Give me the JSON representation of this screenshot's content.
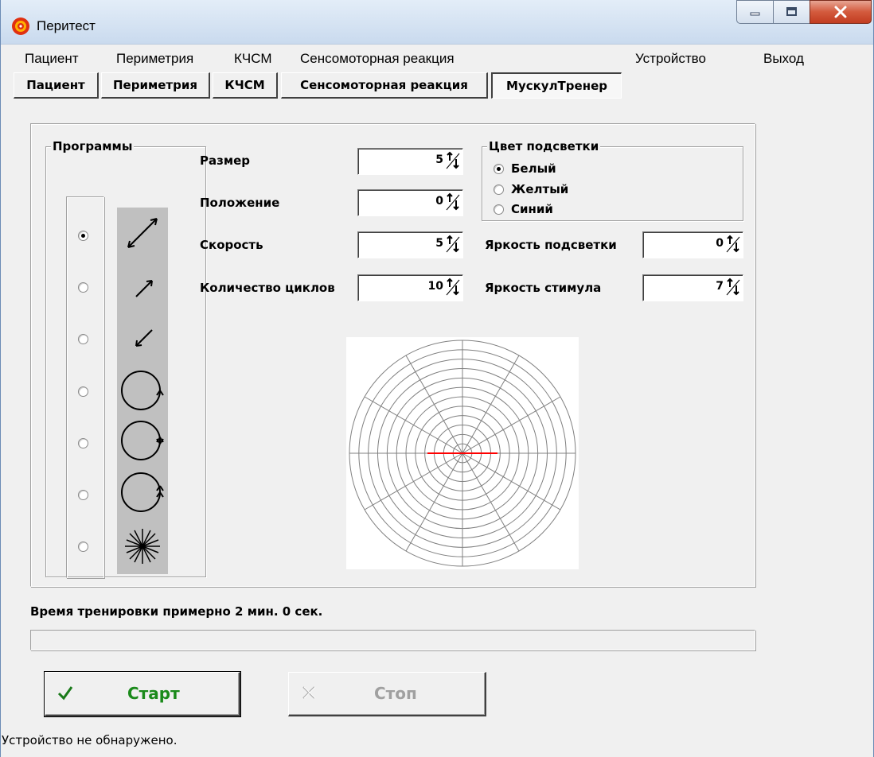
{
  "window": {
    "title": "Перитест",
    "app_icon": "peritest-app-icon",
    "controls": [
      "minimize-icon",
      "maximize-icon",
      "close-icon"
    ]
  },
  "menu": {
    "items": [
      "Пациент",
      "Периметрия",
      "КЧСМ",
      "Сенсомоторная реакция",
      "Устройство",
      "Выход"
    ]
  },
  "tabs": {
    "items": [
      "Пациент",
      "Периметрия",
      "КЧСМ",
      "Сенсомоторная реакция",
      "МускулТренер"
    ],
    "active": "МускулТренер"
  },
  "programs": {
    "title": "Программы",
    "selected_index": 0,
    "icons": [
      "diagonal-double-arrow-icon",
      "arrow-up-right-icon",
      "arrow-down-left-icon",
      "circle-arrow-icon",
      "circle-double-arrow-icon",
      "circle-triple-arrow-icon",
      "star-burst-icon"
    ]
  },
  "params": {
    "size": {
      "label": "Размер",
      "value": "5"
    },
    "position": {
      "label": "Положение",
      "value": "0"
    },
    "speed": {
      "label": "Скорость",
      "value": "5"
    },
    "cycles": {
      "label": "Количество циклов",
      "value": "10"
    },
    "backlight_brightness": {
      "label": "Яркость подсветки",
      "value": "0"
    },
    "stimulus_brightness": {
      "label": "Яркость стимула",
      "value": "7"
    }
  },
  "backlight_color": {
    "title": "Цвет подсветки",
    "options": [
      "Белый",
      "Желтый",
      "Синий"
    ],
    "selected": "Белый"
  },
  "polar": {
    "rings": 12,
    "spokes": 12,
    "stimulus_color": "#ff0000",
    "line_color": "#808080"
  },
  "training_time": "Время тренировки примерно 2 мин. 0 сек.",
  "progress": {
    "value": 0
  },
  "buttons": {
    "start": {
      "label": "Старт",
      "icon": "check-icon",
      "color": "#1a8a1a"
    },
    "stop": {
      "label": "Стоп",
      "icon": "cross-icon",
      "color": "#a0a0a0"
    }
  },
  "status": "Устройство не обнаружено."
}
